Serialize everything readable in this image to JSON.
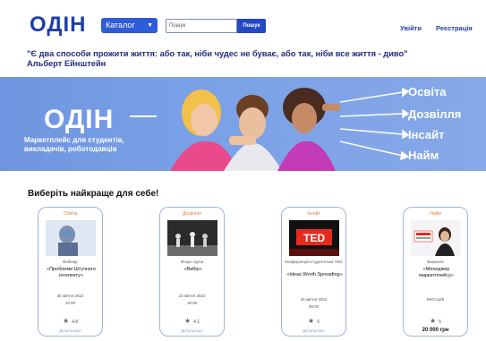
{
  "header": {
    "logo": "ОДІН",
    "catalog_label": "Каталог",
    "search_placeholder": "Пошук",
    "search_button": "Пошук",
    "login": "Увійти",
    "register": "Реєстрація"
  },
  "quote": {
    "text": "\"Є два способи прожити життя: або так, ніби чудес не буває, або так, ніби все життя - диво\"",
    "author": "Альберт Ейнштейн"
  },
  "hero": {
    "title": "ОДІН",
    "subtitle": "Маркетплейс для студентів, викладачів, роботодавців",
    "items": [
      "Освіта",
      "Дозвілля",
      "Інсайт",
      "Найм"
    ]
  },
  "section_title": "Виберіть найкраще для себе!",
  "cards": [
    {
      "category": "Освіта",
      "type": "Вебінар",
      "name": "«Проблеми Штучного інтелекту»",
      "date": "30 квітня 2022",
      "time": "10:00",
      "rating": "4.8",
      "footer": "Детальніше"
    },
    {
      "category": "Дозвілля",
      "type": "Фокус-група",
      "name": "«Вибір»",
      "date": "23 квітня 2022",
      "time": "18:00",
      "rating": "4.1",
      "footer": "Детальніше"
    },
    {
      "category": "Інсайт",
      "type": "Конференція-студентська TED",
      "name": "«Ideas Worth Spreading»",
      "date": "25 квітня 2022",
      "time": "09:00",
      "rating": "5",
      "footer": "Детальніше"
    },
    {
      "category": "Найм",
      "type": "Вакансія",
      "name": "«Менеджер маркетплейсу»",
      "date": "ЕКО-ЦІЛІ",
      "rating": "5",
      "price": "20 000 грн"
    }
  ],
  "colors": {
    "brand": "#1f3fa6",
    "hero_bg": "#7aa0e6",
    "accent": "#e07a3a"
  }
}
